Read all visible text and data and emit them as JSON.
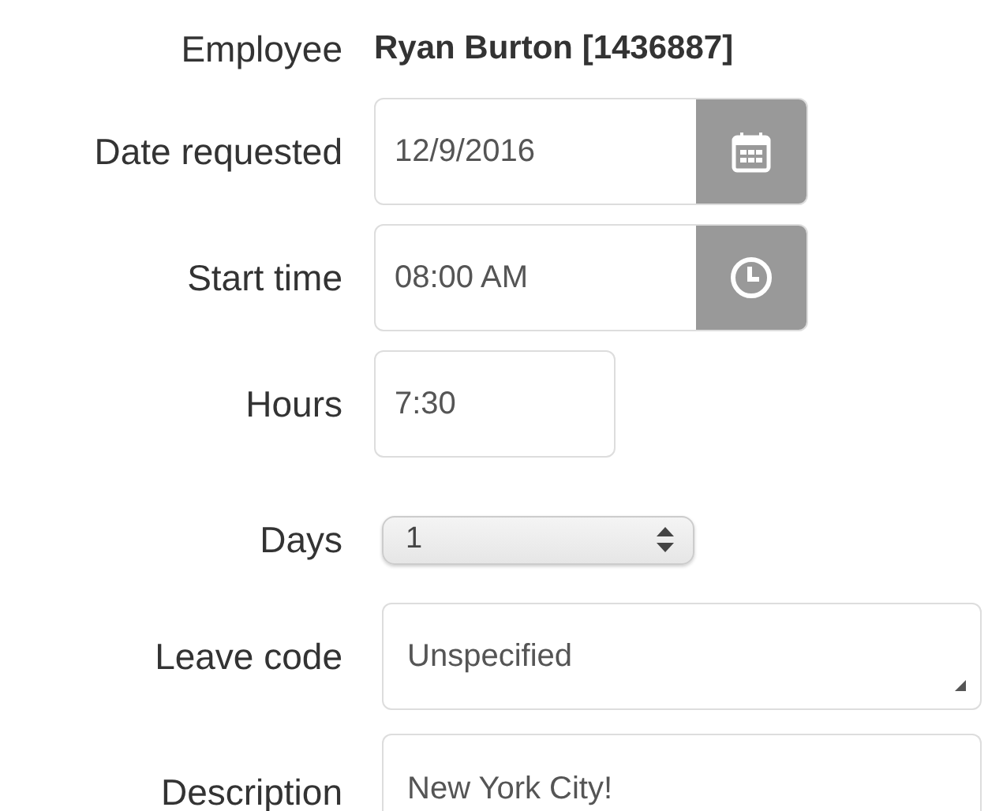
{
  "fields": [
    {
      "kind": "text",
      "label": "Employee",
      "value": "Ryan Burton [1436887]"
    },
    {
      "kind": "date",
      "label": "Date requested",
      "value": "12/9/2016"
    },
    {
      "kind": "time",
      "label": "Start time",
      "value": "08:00 AM"
    },
    {
      "kind": "input",
      "label": "Hours",
      "value": "7:30"
    },
    {
      "kind": "stepper",
      "label": "Days",
      "value": "1"
    },
    {
      "kind": "dropdown",
      "label": "Leave code",
      "value": "Unspecified"
    },
    {
      "kind": "textarea",
      "label": "Description",
      "value": "New York City!"
    }
  ]
}
